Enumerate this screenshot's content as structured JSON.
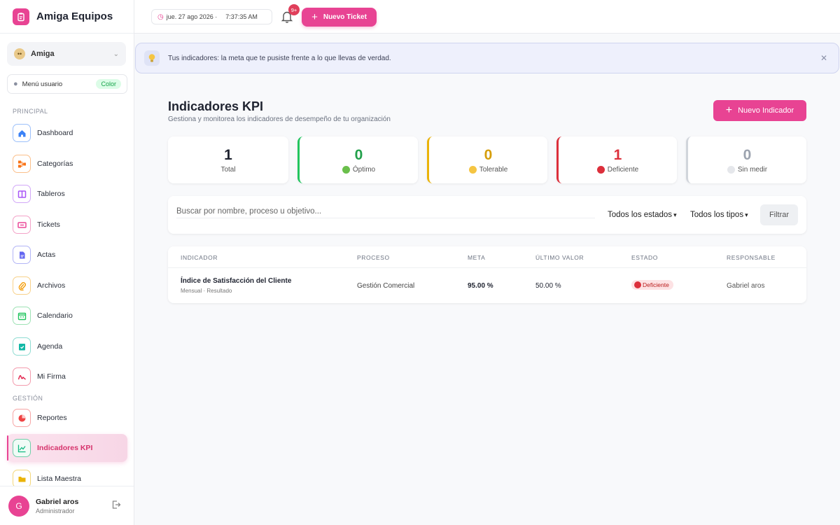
{
  "app": {
    "name": "Amiga Equipos"
  },
  "workspace": {
    "name": "Amiga"
  },
  "user_menu": {
    "label": "Menú usuario",
    "badge": "Color"
  },
  "sidebar": {
    "section_principal": "PRINCIPAL",
    "section_gestion": "GESTIÓN",
    "items": [
      {
        "label": "Dashboard",
        "icon": "home-icon",
        "color": "#3b82f6"
      },
      {
        "label": "Categorías",
        "icon": "sitemap-icon",
        "color": "#f97316"
      },
      {
        "label": "Tableros",
        "icon": "board-icon",
        "color": "#a855f7"
      },
      {
        "label": "Tickets",
        "icon": "ticket-icon",
        "color": "#ec4899"
      },
      {
        "label": "Actas",
        "icon": "document-icon",
        "color": "#6366f1"
      },
      {
        "label": "Archivos",
        "icon": "paperclip-icon",
        "color": "#f59e0b"
      },
      {
        "label": "Calendario",
        "icon": "calendar-icon",
        "color": "#22c55e"
      },
      {
        "label": "Agenda",
        "icon": "agenda-icon",
        "color": "#14b8a6"
      },
      {
        "label": "Mi Firma",
        "icon": "signature-icon",
        "color": "#e11d48"
      },
      {
        "label": "Reportes",
        "icon": "pie-chart-icon",
        "color": "#ef4444"
      },
      {
        "label": "Indicadores KPI",
        "icon": "line-chart-icon",
        "color": "#10b981"
      },
      {
        "label": "Lista Maestra",
        "icon": "folder-icon",
        "color": "#eab308"
      }
    ]
  },
  "footer_user": {
    "initial": "G",
    "name": "Gabriel aros",
    "role": "Administrador"
  },
  "topbar": {
    "date": "jue. 27 ago 2026 ·",
    "time": "7:37:35 AM",
    "notif_count": "9+",
    "new_ticket": "Nuevo Ticket"
  },
  "banner": {
    "text": "Tus indicadores: la meta que te pusiste frente a lo que llevas de verdad."
  },
  "page": {
    "title": "Indicadores KPI",
    "subtitle": "Gestiona y monitorea los indicadores de desempeño de tu organización",
    "new_button": "Nuevo Indicador"
  },
  "kpis": [
    {
      "value": "1",
      "label": "Total",
      "color": "#1f2330"
    },
    {
      "value": "0",
      "label": "Óptimo",
      "color": "#22a04b"
    },
    {
      "value": "0",
      "label": "Tolerable",
      "color": "#d69e0b"
    },
    {
      "value": "1",
      "label": "Deficiente",
      "color": "#dc2f3b"
    },
    {
      "value": "0",
      "label": "Sin medir",
      "color": "#9ca3af"
    }
  ],
  "filters": {
    "search_placeholder": "Buscar por nombre, proceso u objetivo...",
    "status_select": "Todos los estados",
    "type_select": "Todos los tipos",
    "filter_button": "Filtrar"
  },
  "table": {
    "headers": [
      "INDICADOR",
      "PROCESO",
      "META",
      "ÚLTIMO VALOR",
      "ESTADO",
      "RESPONSABLE"
    ],
    "rows": [
      {
        "name": "Índice de Satisfacción del Cliente",
        "meta_info": "Mensual · Resultado",
        "process": "Gestión Comercial",
        "target": "95.00 %",
        "last_value": "50.00 %",
        "status": "Deficiente",
        "owner": "Gabriel aros"
      }
    ]
  }
}
